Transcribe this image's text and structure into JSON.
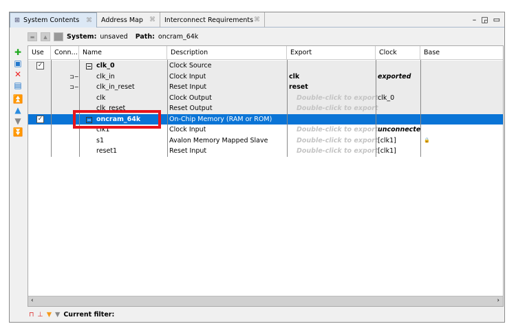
{
  "tabs": [
    {
      "label": "System Contents",
      "close": "⌘"
    },
    {
      "label": "Address Map",
      "close": "⌘"
    },
    {
      "label": "Interconnect Requirements",
      "close": "⌘"
    }
  ],
  "toolbar": {
    "system_label": "System:",
    "system_value": "unsaved",
    "path_label": "Path:",
    "path_value": "oncram_64k"
  },
  "columns": [
    "Use",
    "Conn…",
    "Name",
    "Description",
    "Export",
    "Clock",
    "Base"
  ],
  "rows": [
    {
      "name": "clk_0",
      "description": "Clock Source",
      "export": "",
      "clock": ""
    },
    {
      "name": "clk_in",
      "description": "Clock Input",
      "export": "clk",
      "clock": "exported"
    },
    {
      "name": "clk_in_reset",
      "description": "Reset Input",
      "export": "reset",
      "clock": ""
    },
    {
      "name": "clk",
      "description": "Clock Output",
      "export": "Double-click to export",
      "clock": "clk_0"
    },
    {
      "name": "clk_reset",
      "description": "Reset Output",
      "export": "Double-click to export",
      "clock": ""
    },
    {
      "name": "oncram_64k",
      "description": "On-Chip Memory (RAM or ROM)",
      "export": "",
      "clock": ""
    },
    {
      "name": "clk1",
      "description": "Clock Input",
      "export": "Double-click to export",
      "clock": "unconnected"
    },
    {
      "name": "s1",
      "description": "Avalon Memory Mapped Slave",
      "export": "Double-click to export",
      "clock": "[clk1]"
    },
    {
      "name": "reset1",
      "description": "Reset Input",
      "export": "Double-click to export",
      "clock": "[clk1]"
    }
  ],
  "filter": {
    "label": "Current filter:"
  },
  "colors": {
    "selection": "#0a74d6",
    "highlight": "#e8141b"
  }
}
